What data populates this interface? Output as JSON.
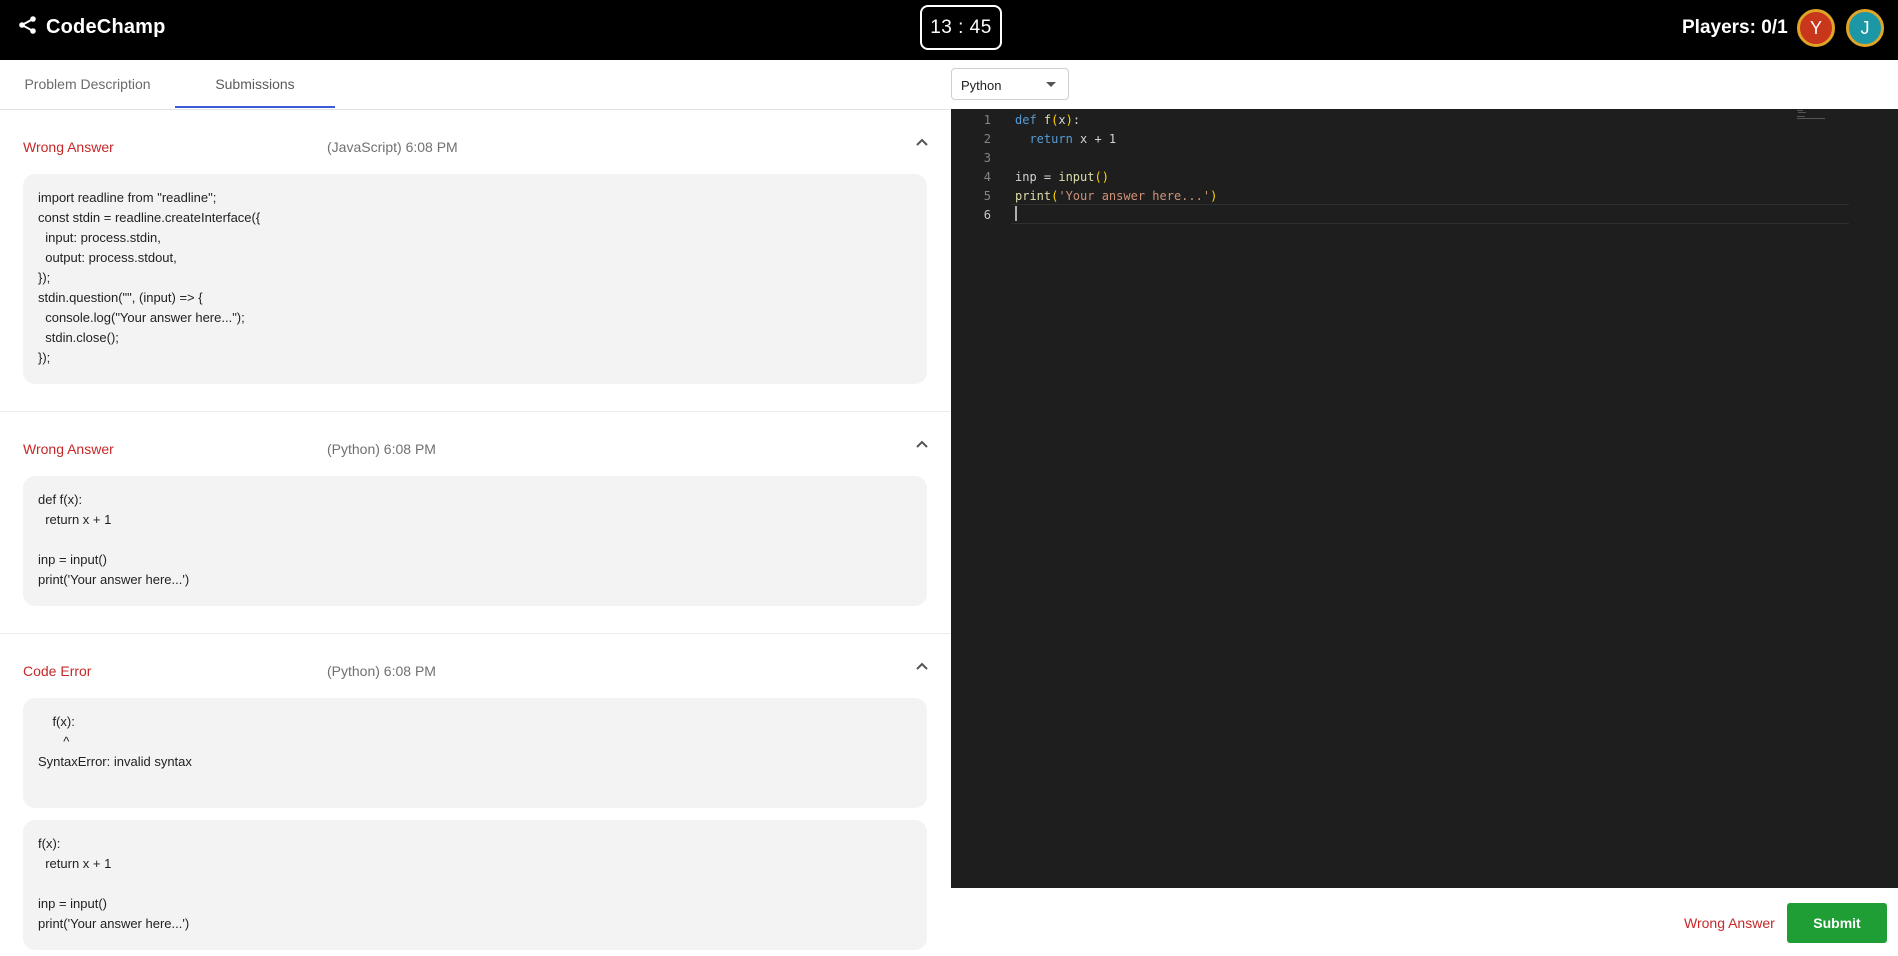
{
  "header": {
    "brand": "CodeChamp",
    "timer": "13 : 45",
    "players": "Players: 0/1",
    "avatars": [
      "Y",
      "J"
    ]
  },
  "tabs": [
    {
      "label": "Problem Description"
    },
    {
      "label": "Submissions"
    }
  ],
  "submissions": [
    {
      "status": "Wrong Answer",
      "meta": "(JavaScript) 6:08 PM",
      "code": "import readline from \"readline\";\nconst stdin = readline.createInterface({\n  input: process.stdin,\n  output: process.stdout,\n});\nstdin.question(\"\", (input) => {\n  console.log(\"Your answer here...\");\n  stdin.close();\n});"
    },
    {
      "status": "Wrong Answer",
      "meta": "(Python) 6:08 PM",
      "code": "def f(x):\n  return x + 1\n\ninp = input()\nprint('Your answer here...')"
    },
    {
      "status": "Code Error",
      "meta": "(Python) 6:08 PM",
      "error": "    f(x):\n       ^\nSyntaxError: invalid syntax\n",
      "code": "f(x):\n  return x + 1\n\ninp = input()\nprint('Your answer here...')"
    }
  ],
  "editor": {
    "language": "Python",
    "line_numbers": [
      "1",
      "2",
      "3",
      "4",
      "5",
      "6"
    ]
  },
  "footer": {
    "status": "Wrong Answer",
    "submit_label": "Submit"
  },
  "colors": {
    "header_bg": "#000000",
    "error_red": "#c62828",
    "tab_indicator": "#3b5bdb",
    "submit_green": "#1e9e34",
    "editor_bg": "#1e1e1e"
  }
}
